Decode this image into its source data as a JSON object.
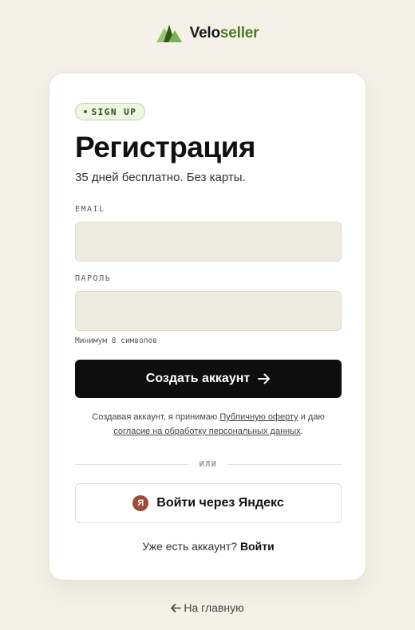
{
  "brand": {
    "name_part1": "Velo",
    "name_part2": "seller",
    "icon": "mountain-logo-icon"
  },
  "badge": {
    "label": "SIGN UP"
  },
  "header": {
    "title": "Регистрация",
    "subtitle": "35 дней бесплатно. Без карты."
  },
  "form": {
    "email_label": "EMAIL",
    "email_value": "",
    "password_label": "ПАРОЛЬ",
    "password_value": "",
    "password_hint": "Минимум 8 символов",
    "submit_label": "Создать аккаунт",
    "submit_icon": "arrow-right-icon"
  },
  "legal": {
    "prefix": "Создавая аккаунт, я принимаю ",
    "offer_link": "Публичную оферту",
    "middle": " и даю",
    "consent_link": "согласие на обработку персональных данных",
    "suffix": "."
  },
  "divider": {
    "label": "ИЛИ"
  },
  "oauth": {
    "yandex_label": "Войти через Яндекс",
    "yandex_icon_letter": "Я"
  },
  "login": {
    "question": "Уже есть аккаунт?",
    "link": "Войти"
  },
  "footer": {
    "home_link": "На главную",
    "home_icon": "arrow-left-icon"
  },
  "colors": {
    "background": "#f4f2e8",
    "accent_green": "#4d7a1f",
    "button": "#0e0e0e",
    "input_bg": "#eeece1"
  }
}
